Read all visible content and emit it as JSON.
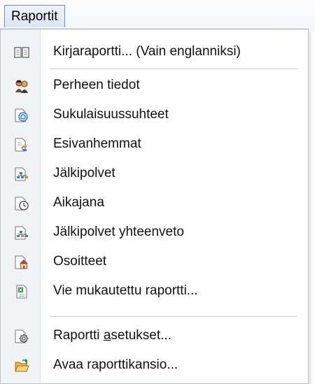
{
  "menu": {
    "title": "Raportit",
    "items": [
      {
        "label": "Kirjaraportti... (Vain englanniksi)",
        "icon": "book-icon"
      },
      {
        "label": "Perheen tiedot",
        "icon": "family-icon"
      },
      {
        "label": "Sukulaisuussuhteet",
        "icon": "relationship-icon"
      },
      {
        "label": "Esivanhemmat",
        "icon": "ancestors-icon"
      },
      {
        "label": "Jälkipolvet",
        "icon": "descendants-icon"
      },
      {
        "label": "Aikajana",
        "icon": "timeline-icon"
      },
      {
        "label": "Jälkipolvet yhteenveto",
        "icon": "descendants-summary-icon"
      },
      {
        "label": "Osoitteet",
        "icon": "addresses-icon"
      },
      {
        "label": "Vie mukautettu raportti...",
        "icon": "excel-export-icon"
      },
      {
        "label_pre": "Raportti ",
        "label_ul": "a",
        "label_post": "setukset...",
        "icon": "report-settings-icon"
      },
      {
        "label": "Avaa raporttikansio...",
        "icon": "open-folder-icon"
      }
    ]
  }
}
